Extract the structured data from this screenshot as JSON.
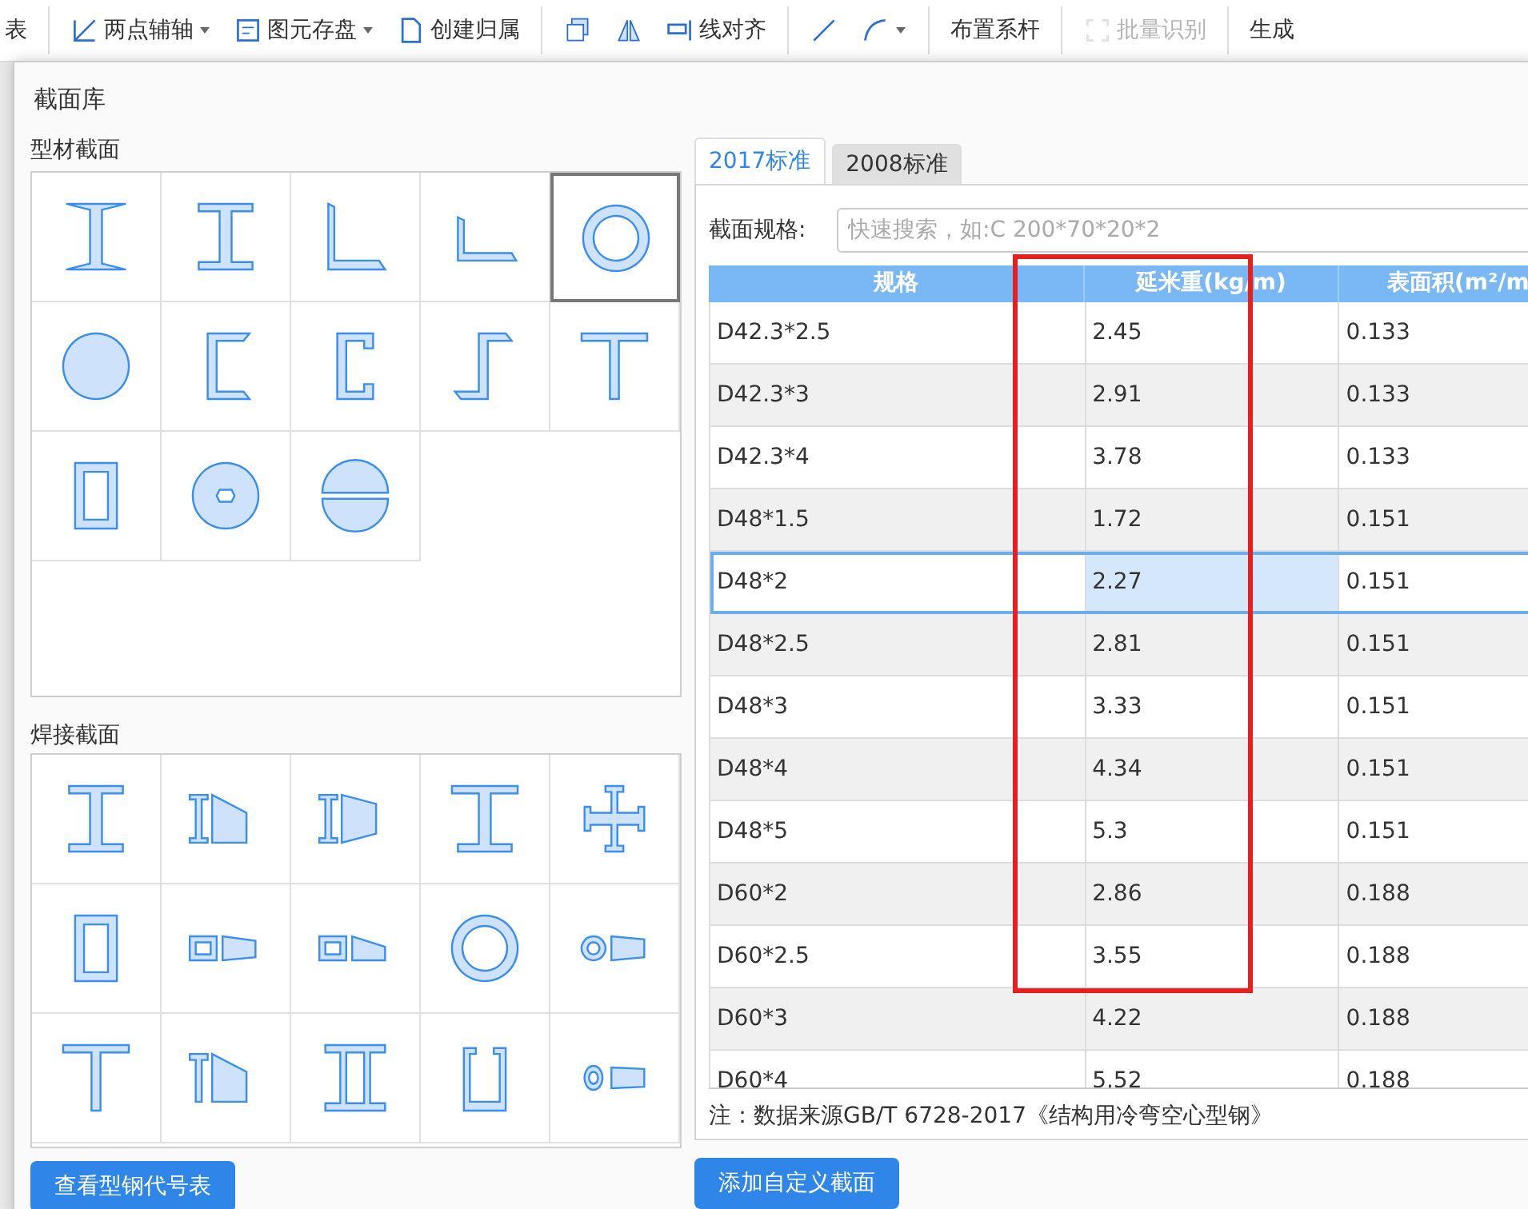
{
  "toolbar": [
    {
      "label": "表",
      "dropdown": false,
      "disabled": false
    },
    {
      "label": "两点辅轴",
      "dropdown": true,
      "disabled": false
    },
    {
      "label": "图元存盘",
      "dropdown": true,
      "disabled": false
    },
    {
      "label": "创建归属",
      "dropdown": false,
      "disabled": false
    },
    {
      "dropdown": false,
      "disabled": false
    },
    {
      "dropdown": false,
      "disabled": false
    },
    {
      "label": "线对齐",
      "dropdown": false,
      "disabled": false
    },
    {
      "dropdown": false,
      "disabled": false
    },
    {
      "dropdown": true,
      "disabled": false
    },
    {
      "label": "布置系杆",
      "dropdown": false,
      "disabled": false
    },
    {
      "label": "批量识别",
      "dropdown": false,
      "disabled": true
    },
    {
      "label": "生成",
      "dropdown": false,
      "disabled": false
    }
  ],
  "dialog": {
    "title": "截面库",
    "profile_sections": {
      "label": "型材截面",
      "items": [
        {
          "kind": "ibeam-taper",
          "selected": false
        },
        {
          "kind": "ibeam",
          "selected": false
        },
        {
          "kind": "angle-equal",
          "selected": false
        },
        {
          "kind": "angle-unequal",
          "selected": false
        },
        {
          "kind": "pipe",
          "selected": true
        },
        {
          "kind": "round-bar",
          "selected": false
        },
        {
          "kind": "channel",
          "selected": false
        },
        {
          "kind": "lipped-channel",
          "selected": false
        },
        {
          "kind": "z-section",
          "selected": false
        },
        {
          "kind": "tee",
          "selected": false
        },
        {
          "kind": "rect-tube",
          "selected": false
        },
        {
          "kind": "hex-disc",
          "selected": false
        },
        {
          "kind": "split-sphere",
          "selected": false
        }
      ]
    },
    "welded_sections": {
      "label": "焊接截面",
      "items": [
        {
          "kind": "ibeam",
          "selected": false
        },
        {
          "kind": "ibeam-taper-pair",
          "selected": false
        },
        {
          "kind": "ibeam-taper-pair2",
          "selected": false
        },
        {
          "kind": "ibeam-wide",
          "selected": false
        },
        {
          "kind": "cross",
          "selected": false
        },
        {
          "kind": "rect-tube",
          "selected": false
        },
        {
          "kind": "box-taper",
          "selected": false
        },
        {
          "kind": "box-taper2",
          "selected": false
        },
        {
          "kind": "pipe",
          "selected": false
        },
        {
          "kind": "pipe-taper",
          "selected": false
        },
        {
          "kind": "tee",
          "selected": false
        },
        {
          "kind": "tee-taper",
          "selected": false
        },
        {
          "kind": "double-web",
          "selected": false
        },
        {
          "kind": "u-channel",
          "selected": false
        },
        {
          "kind": "ellipse-taper",
          "selected": false
        }
      ]
    },
    "code_table_button": "查看型钢代号表",
    "tabs": [
      {
        "label": "2017标准",
        "selected": true
      },
      {
        "label": "2008标准",
        "selected": false
      }
    ],
    "search": {
      "label": "截面规格:",
      "placeholder": "快速搜索，如:C 200*70*20*2"
    },
    "table": {
      "columns": [
        "规格",
        "延米重(kg/m)",
        "表面积(m²/m"
      ],
      "rows": [
        {
          "cells": [
            "D42.3*2.5",
            "2.45",
            "0.133"
          ],
          "selected": false
        },
        {
          "cells": [
            "D42.3*3",
            "2.91",
            "0.133"
          ],
          "selected": false
        },
        {
          "cells": [
            "D42.3*4",
            "3.78",
            "0.133"
          ],
          "selected": false
        },
        {
          "cells": [
            "D48*1.5",
            "1.72",
            "0.151"
          ],
          "selected": false
        },
        {
          "cells": [
            "D48*2",
            "2.27",
            "0.151"
          ],
          "selected": true
        },
        {
          "cells": [
            "D48*2.5",
            "2.81",
            "0.151"
          ],
          "selected": false
        },
        {
          "cells": [
            "D48*3",
            "3.33",
            "0.151"
          ],
          "selected": false
        },
        {
          "cells": [
            "D48*4",
            "4.34",
            "0.151"
          ],
          "selected": false
        },
        {
          "cells": [
            "D48*5",
            "5.3",
            "0.151"
          ],
          "selected": false
        },
        {
          "cells": [
            "D60*2",
            "2.86",
            "0.188"
          ],
          "selected": false
        },
        {
          "cells": [
            "D60*2.5",
            "3.55",
            "0.188"
          ],
          "selected": false
        },
        {
          "cells": [
            "D60*3",
            "4.22",
            "0.188"
          ],
          "selected": false
        },
        {
          "cells": [
            "D60*4",
            "5.52",
            "0.188"
          ],
          "selected": false
        }
      ]
    },
    "note": "注：数据来源GB/T 6728-2017《结构用冷弯空心型钢》",
    "add_button": "添加自定义截面"
  }
}
